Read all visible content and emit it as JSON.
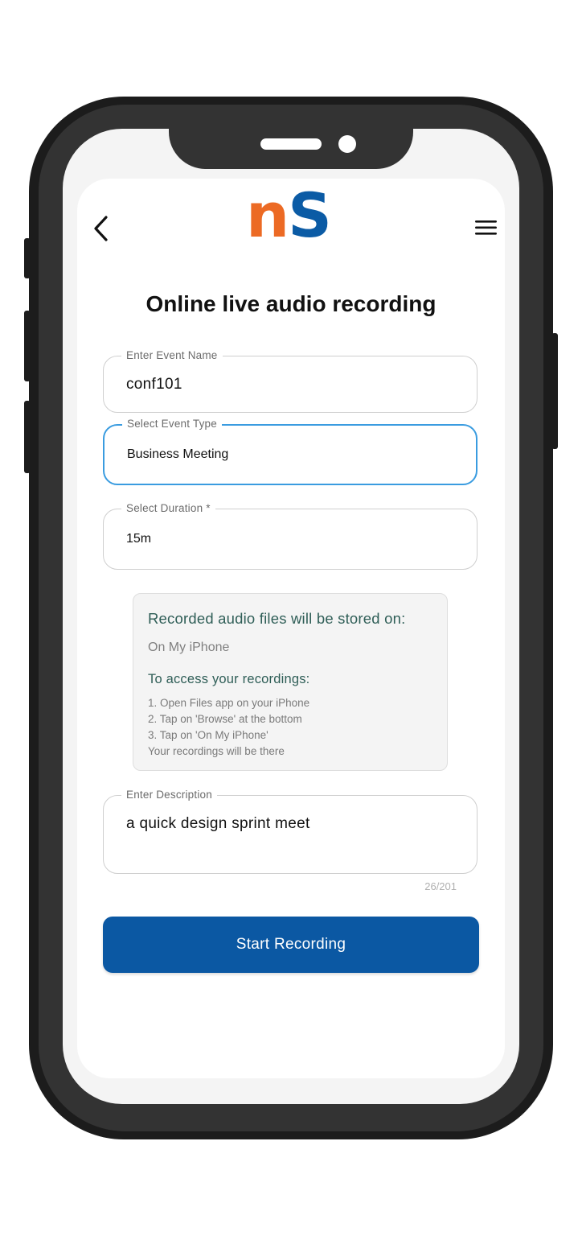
{
  "header": {
    "logo": {
      "letter_1": "n",
      "letter_2": "S"
    },
    "back_icon": "chevron-left",
    "menu_icon": "hamburger-menu"
  },
  "page": {
    "title": "Online live audio recording"
  },
  "form": {
    "event_name": {
      "label": "Enter Event Name",
      "value": "conf101"
    },
    "event_type": {
      "label": "Select Event Type",
      "value": "Business Meeting"
    },
    "duration": {
      "label": "Select Duration *",
      "value": "15m"
    },
    "description": {
      "label": "Enter Description",
      "value": "a quick design sprint meet",
      "counter": "26/201"
    }
  },
  "info": {
    "heading": "Recorded audio files will be stored on:",
    "location": "On My iPhone",
    "subheading": "To access your recordings:",
    "steps": [
      "1. Open Files app on your iPhone",
      "2. Tap on 'Browse' at the bottom",
      "3. Tap on 'On My iPhone'",
      "Your recordings will be there"
    ]
  },
  "actions": {
    "start_label": "Start Recording"
  },
  "colors": {
    "logo_n": "#ec6a24",
    "logo_s": "#0b5ba5",
    "primary": "#0b58a3",
    "focus": "#3a9ce0",
    "info_text": "#2f5e57"
  }
}
